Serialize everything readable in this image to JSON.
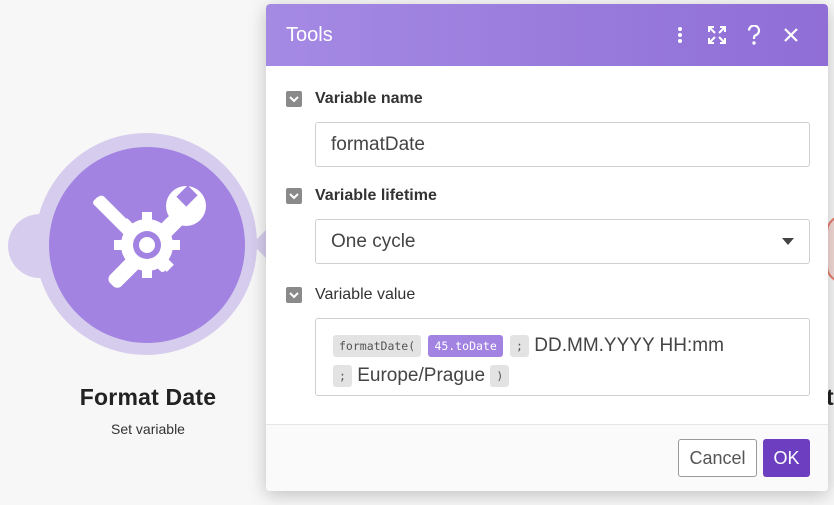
{
  "module": {
    "title": "Format Date",
    "subtitle": "Set variable",
    "icon": "tools-icon",
    "next_module_letter": "t"
  },
  "dialog": {
    "title": "Tools",
    "header_icons": [
      "more-vertical-icon",
      "expand-icon",
      "help-icon",
      "close-icon"
    ],
    "fields": {
      "variable_name": {
        "label": "Variable name",
        "value": "formatDate"
      },
      "variable_lifetime": {
        "label": "Variable lifetime",
        "value": "One cycle"
      },
      "variable_value": {
        "label": "Variable value",
        "tokens": {
          "fn_open": "formatDate(",
          "var": "45.toDate",
          "sep1": ";",
          "text1": "DD.MM.YYYY HH:mm",
          "sep2": ";",
          "text2": "Europe/Prague",
          "fn_close": ")"
        }
      }
    },
    "buttons": {
      "cancel": "Cancel",
      "ok": "OK"
    }
  },
  "colors": {
    "brand": "#a283e2",
    "header": "#9474dd",
    "ok_button": "#6d3fc0"
  }
}
